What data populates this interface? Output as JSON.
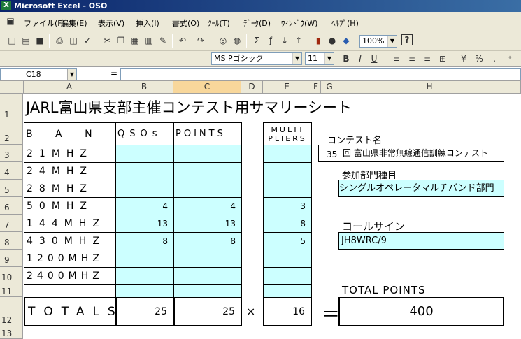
{
  "app": {
    "title": "Microsoft Excel - OSO"
  },
  "menu": [
    "ファイル(F)",
    "編集(E)",
    "表示(V)",
    "挿入(I)",
    "書式(O)",
    "ﾂｰﾙ(T)",
    "ﾃﾞｰﾀ(D)",
    "ｳｨﾝﾄﾞｳ(W)",
    "ﾍﾙﾌﾟ(H)"
  ],
  "toolbar": {
    "zoom": "100%",
    "font_name": "MS Pゴシック",
    "font_size": "11"
  },
  "formula_bar": {
    "name_box": "C18",
    "equals": "="
  },
  "columns": [
    "A",
    "B",
    "C",
    "D",
    "E",
    "F",
    "G",
    "H"
  ],
  "rows": [
    "1",
    "2",
    "3",
    "4",
    "5",
    "6",
    "7",
    "8",
    "9",
    "10",
    "11",
    "12",
    "13"
  ],
  "sheet": {
    "title": "JARL富山県支部主催コンテスト用サマリーシート",
    "headers": {
      "band": "B A N D",
      "qsos": "QSOs",
      "points": "POINTS",
      "multi1": "MULTI",
      "multi2": "PLIERS"
    },
    "bands": [
      {
        "band": "21MHZ",
        "qsos": "",
        "points": "",
        "multi": ""
      },
      {
        "band": "24MHZ",
        "qsos": "",
        "points": "",
        "multi": ""
      },
      {
        "band": "28MHZ",
        "qsos": "",
        "points": "",
        "multi": ""
      },
      {
        "band": "50MHZ",
        "qsos": "4",
        "points": "4",
        "multi": "3"
      },
      {
        "band": "144MHZ",
        "qsos": "13",
        "points": "13",
        "multi": "8"
      },
      {
        "band": "430MHZ",
        "qsos": "8",
        "points": "8",
        "multi": "5"
      },
      {
        "band": "1200MHZ",
        "qsos": "",
        "points": "",
        "multi": ""
      },
      {
        "band": "2400MHZ",
        "qsos": "",
        "points": "",
        "multi": ""
      },
      {
        "band": "",
        "qsos": "",
        "points": "",
        "multi": ""
      }
    ],
    "totals": {
      "label": "TOTALS",
      "qsos": "25",
      "points": "25",
      "times": "×",
      "multi": "16",
      "equals": "＝",
      "total_points": "400"
    },
    "contest_label": "コンテスト名",
    "contest_number": "35",
    "contest_name": "回 富山県非常無線通信訓練コンテスト",
    "category_label": "参加部門種目",
    "category_value": "シングルオペレータマルチバンド部門",
    "callsign_label": "コールサイン",
    "callsign_value": "JH8WRC/9",
    "total_points_label": "TOTAL POINTS"
  },
  "colors": {
    "cyan": "#ccffff",
    "titlebar": "#0a246a"
  }
}
